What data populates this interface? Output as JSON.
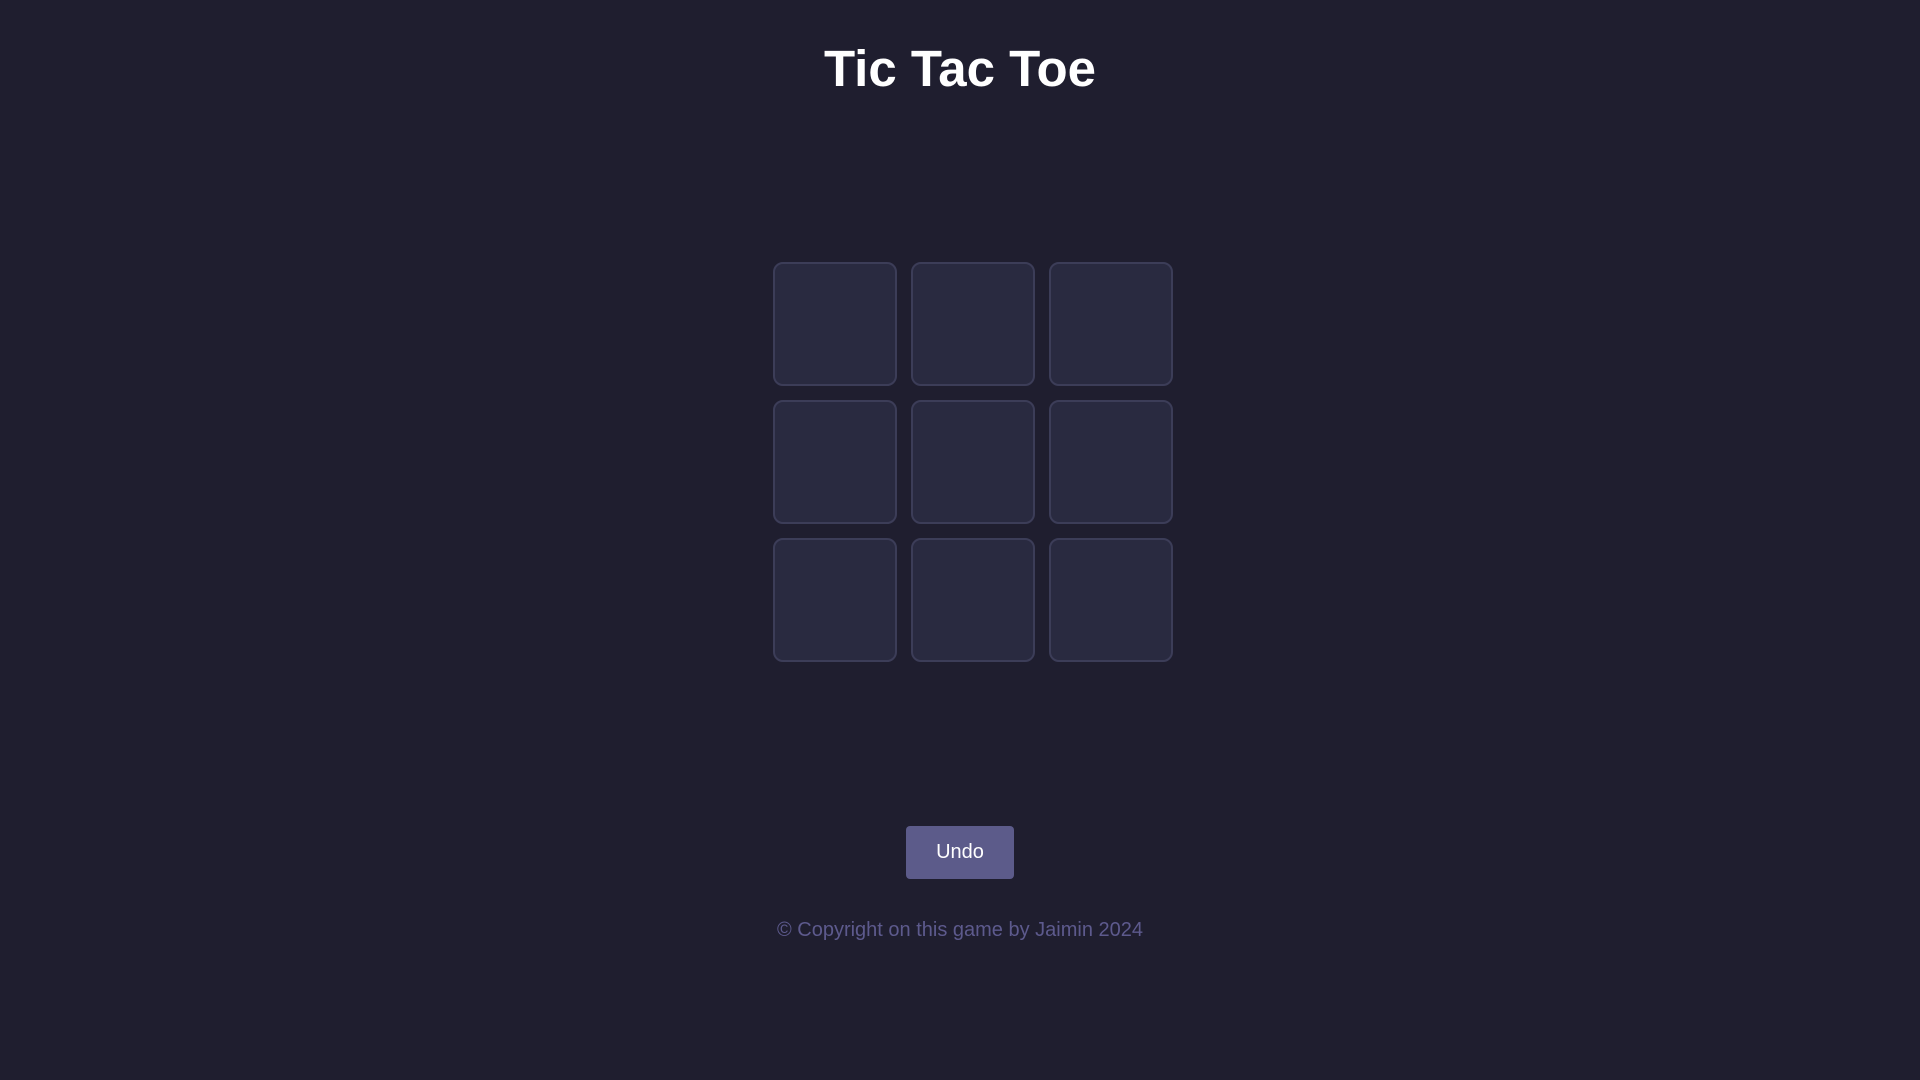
{
  "header": {
    "title": "Tic Tac Toe"
  },
  "board": {
    "cells": [
      "",
      "",
      "",
      "",
      "",
      "",
      "",
      "",
      ""
    ]
  },
  "controls": {
    "undo_label": "Undo"
  },
  "footer": {
    "copyright": "© Copyright on this game by Jaimin 2024"
  },
  "colors": {
    "background": "#1f1e2f",
    "cell_fill": "#292a40",
    "cell_border": "#3c3d58",
    "button": "#5c5b8a",
    "footer_text": "#5d5a8d"
  }
}
